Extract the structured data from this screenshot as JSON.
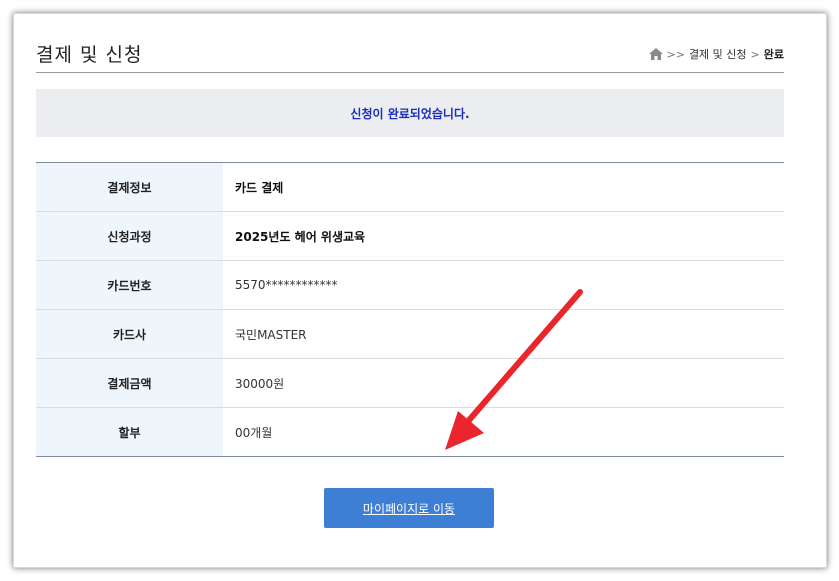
{
  "header": {
    "title": "결제 및 신청",
    "breadcrumb": {
      "separator": ">>",
      "section": "결제 및 신청",
      "separator2": ">",
      "current": "완료"
    }
  },
  "notice": {
    "message": "신청이 완료되었습니다."
  },
  "details": [
    {
      "label": "결제정보",
      "value": "카드 결제"
    },
    {
      "label": "신청과정",
      "value": "2025년도 헤어 위생교육"
    },
    {
      "label": "카드번호",
      "value": "5570************"
    },
    {
      "label": "카드사",
      "value": "국민MASTER"
    },
    {
      "label": "결제금액",
      "value": "30000원"
    },
    {
      "label": "할부",
      "value": "00개월"
    }
  ],
  "actions": {
    "mypage_label": "마이페이지로 이동"
  },
  "colors": {
    "accent": "#3d7fd4",
    "notice_text": "#1a2fb8",
    "annotation_arrow": "#e8262c"
  },
  "icons": {
    "home": "home-icon",
    "annotation": "red-arrow-annotation"
  }
}
